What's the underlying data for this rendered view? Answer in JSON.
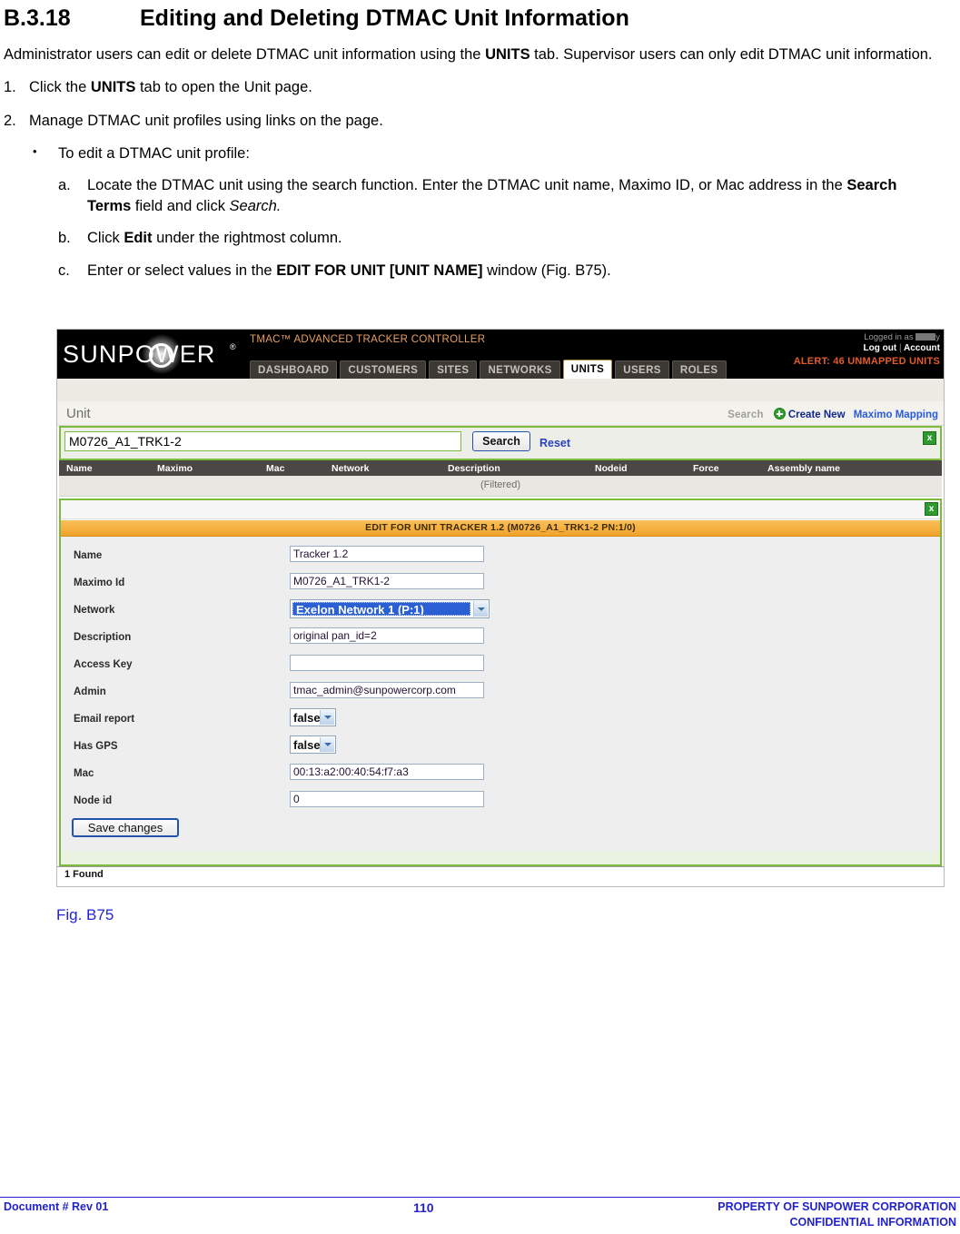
{
  "document": {
    "section_number": "B.3.18",
    "section_title": "Editing and Deleting DTMAC Unit Information",
    "intro_part1": "Administrator users can edit or delete DTMAC unit information using the ",
    "intro_bold": "UNITS",
    "intro_part2": " tab. Supervisor users can only edit DTMAC unit information.",
    "step1_marker": "1.",
    "step1_part1": "Click the ",
    "step1_bold": "UNITS",
    "step1_part2": " tab to open the Unit page.",
    "step2_marker": "2.",
    "step2_text": "Manage DTMAC unit profiles using links on the page.",
    "bullet_marker": "•",
    "bullet_text": "To edit a DTMAC unit profile:",
    "sub_a_marker": "a.",
    "sub_a_part1": "Locate the DTMAC unit using the search function. Enter the DTMAC unit name, Maximo ID, or Mac address in the ",
    "sub_a_bold": "Search Terms",
    "sub_a_part2": " field and click ",
    "sub_a_italic": "Search.",
    "sub_b_marker": "b.",
    "sub_b_part1": "Click ",
    "sub_b_bold": "Edit",
    "sub_b_part2": " under the rightmost column.",
    "sub_c_marker": "c.",
    "sub_c_part1": "Enter or select values in the ",
    "sub_c_bold": "EDIT FOR UNIT [UNIT NAME]",
    "sub_c_part2": " window (Fig. B75).",
    "figure_caption": "Fig. B75"
  },
  "footer": {
    "left": "Document #  Rev 01",
    "page_number": "110",
    "right_line1": "PROPERTY OF SUNPOWER CORPORATION",
    "right_line2": "CONFIDENTIAL INFORMATION"
  },
  "app": {
    "logo_text": "SUNPOWER",
    "logo_trademark": "®",
    "title": "TMAC™ ADVANCED TRACKER CONTROLLER",
    "user": {
      "logged_in_label": "Logged in as",
      "logged_in_suffix": "y",
      "logout_label": "Log out",
      "separator": "|",
      "account_label": "Account",
      "alert": "ALERT: 46 UNMAPPED UNITS"
    },
    "tabs": [
      {
        "label": "DASHBOARD",
        "active": false
      },
      {
        "label": "CUSTOMERS",
        "active": false
      },
      {
        "label": "SITES",
        "active": false
      },
      {
        "label": "NETWORKS",
        "active": false
      },
      {
        "label": "UNITS",
        "active": true
      },
      {
        "label": "USERS",
        "active": false
      },
      {
        "label": "ROLES",
        "active": false
      }
    ],
    "page": {
      "heading": "Unit",
      "links": {
        "search": "Search",
        "create_new": "Create New",
        "maximo_mapping": "Maximo Mapping"
      },
      "search": {
        "value": "M0726_A1_TRK1-2",
        "button_label": "Search",
        "reset_label": "Reset",
        "close_label": "x"
      },
      "columns": [
        "Name",
        "Maximo",
        "Mac",
        "Network",
        "Description",
        "Nodeid",
        "Force",
        "Assembly name"
      ],
      "filtered_label": "(Filtered)",
      "edit_panel": {
        "close_label": "x",
        "header": "EDIT FOR UNIT TRACKER 1.2 (M0726_A1_TRK1-2 PN:1/0)",
        "fields": [
          {
            "label": "Name",
            "type": "text",
            "value": "Tracker 1.2"
          },
          {
            "label": "Maximo Id",
            "type": "text",
            "value": "M0726_A1_TRK1-2"
          },
          {
            "label": "Network",
            "type": "select",
            "value": "Exelon Network 1 (P:1)"
          },
          {
            "label": "Description",
            "type": "text",
            "value": "original pan_id=2"
          },
          {
            "label": "Access Key",
            "type": "text",
            "value": ""
          },
          {
            "label": "Admin",
            "type": "text",
            "value": "tmac_admin@sunpowercorp.com"
          },
          {
            "label": "Email report",
            "type": "bool",
            "value": "false"
          },
          {
            "label": "Has GPS",
            "type": "bool",
            "value": "false"
          },
          {
            "label": "Mac",
            "type": "text",
            "value": "00:13:a2:00:40:54:f7:a3"
          },
          {
            "label": "Node id",
            "type": "text",
            "value": "0"
          }
        ],
        "save_label": "Save changes"
      },
      "found_label": "1 Found"
    },
    "colors": {
      "topbar": "#000000",
      "accent_orange": "#e8a060",
      "alert_red": "#e25c2a",
      "panel_green": "#7dbb3c",
      "edit_header_orange": "#f0a32b",
      "link_blue": "#2a5adf"
    }
  }
}
